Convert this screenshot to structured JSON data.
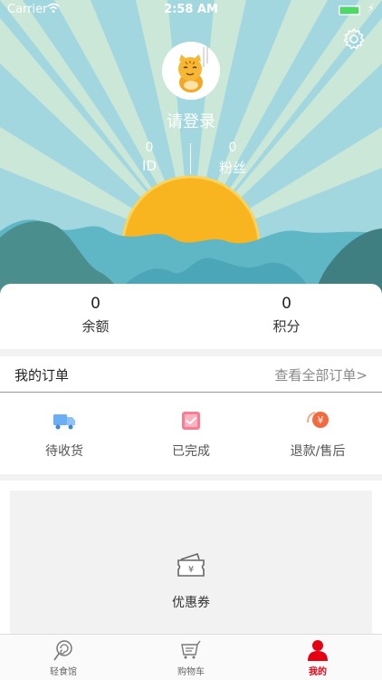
{
  "status_bar": {
    "carrier": "Carrier",
    "time": "2:58 AM"
  },
  "profile": {
    "login_text": "请登录",
    "id_value": "0",
    "id_label": "ID",
    "fans_value": "0",
    "fans_label": "粉丝"
  },
  "balance": {
    "balance_value": "0",
    "balance_label": "余额",
    "points_value": "0",
    "points_label": "积分"
  },
  "orders": {
    "title": "我的订单",
    "view_all": "查看全部订单>",
    "items": [
      {
        "label": "待收货",
        "icon": "truck-icon"
      },
      {
        "label": "已完成",
        "icon": "check-box-icon"
      },
      {
        "label": "退款/售后",
        "icon": "refund-icon"
      }
    ]
  },
  "coupon": {
    "label": "优惠券",
    "icon": "ticket-icon"
  },
  "tabbar": {
    "items": [
      {
        "label": "轻食馆",
        "icon": "lollipop-icon"
      },
      {
        "label": "购物车",
        "icon": "cart-icon"
      },
      {
        "label": "我的",
        "icon": "person-icon"
      }
    ],
    "active_color": "#e60012"
  },
  "colors": {
    "sky": "#9fd3dd",
    "ray": "#c6e6df",
    "sun": "#f9b21d",
    "mountain": "#4aa0b0"
  }
}
